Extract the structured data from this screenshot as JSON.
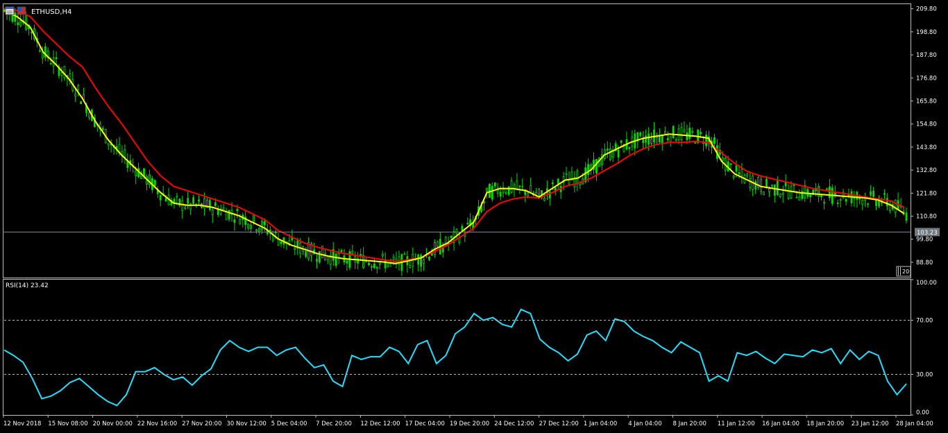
{
  "window": {
    "symbol_label": "ETHUSD,H4",
    "icon": "chart-window-icon"
  },
  "colors": {
    "background": "#000000",
    "frame": "#c0c0c0",
    "candle": "#00dd00",
    "ma_fast": "#ffff00",
    "ma_slow": "#ff0000",
    "rsi": "#1ee0ff",
    "current_price_line": "#7b8b9b",
    "current_price_tag": "#707880"
  },
  "chart_data": [
    {
      "type": "candlestick",
      "title": "ETHUSD,H4",
      "price_axis_ticks": [
        "209.80",
        "198.80",
        "187.80",
        "176.80",
        "165.80",
        "154.80",
        "143.80",
        "132.80",
        "121.80",
        "110.80",
        "99.80",
        "88.80"
      ],
      "ylim": [
        81.5,
        212.0
      ],
      "current_price": 103.23,
      "current_price_label": "103.23",
      "scroll_marker_label": "20",
      "moving_averages": [
        {
          "color": "#ffff00",
          "values": [
            209.0,
            206.0,
            201.0,
            189.0,
            183.0,
            176.0,
            167.0,
            156.0,
            147.0,
            140.0,
            134.0,
            128.0,
            122.0,
            117.0,
            116.0,
            116.0,
            115.0,
            113.0,
            111.0,
            108.0,
            105.0,
            100.0,
            97.0,
            95.0,
            93.0,
            91.5,
            90.5,
            90.0,
            89.5,
            89.0,
            88.2,
            89.5,
            91.0,
            95.0,
            98.0,
            103.0,
            108.0,
            122.0,
            124.0,
            124.0,
            123.0,
            120.0,
            124.0,
            128.0,
            129.0,
            133.0,
            140.0,
            143.0,
            146.0,
            148.0,
            149.0,
            150.0,
            149.5,
            149.0,
            148.0,
            137.0,
            131.0,
            128.0,
            125.0,
            124.0,
            123.0,
            122.0,
            121.5,
            121.0,
            120.5,
            120.0,
            119.5,
            118.5,
            116.0,
            112.0
          ]
        },
        {
          "color": "#ff0000",
          "values": [
            210.0,
            209.0,
            206.0,
            199.0,
            193.0,
            187.0,
            182.0,
            172.0,
            163.0,
            155.0,
            146.0,
            137.0,
            130.0,
            125.0,
            123.0,
            121.0,
            119.0,
            117.0,
            115.0,
            112.0,
            109.0,
            104.0,
            101.0,
            98.0,
            96.0,
            94.5,
            93.0,
            92.0,
            91.0,
            90.0,
            89.2,
            90.0,
            91.0,
            94.0,
            97.0,
            101.0,
            105.0,
            113.0,
            117.0,
            119.0,
            120.0,
            119.5,
            122.0,
            125.0,
            126.5,
            129.0,
            132.5,
            136.0,
            140.0,
            143.0,
            145.0,
            146.0,
            146.0,
            146.5,
            146.0,
            141.0,
            136.0,
            132.0,
            130.0,
            128.5,
            127.0,
            125.5,
            124.0,
            123.0,
            122.0,
            121.0,
            120.0,
            119.0,
            118.0,
            115.0
          ]
        }
      ]
    },
    {
      "type": "line",
      "title": "RSI(14) 23.42",
      "ylim": [
        0,
        100
      ],
      "y_ticks": [
        "100.00",
        "70.00",
        "30.00",
        "0.00"
      ],
      "levels": [
        70,
        30
      ],
      "series": [
        {
          "color": "#1ee0ff",
          "values": [
            48,
            44,
            39,
            27,
            12,
            14,
            18,
            24,
            27,
            21,
            15,
            10,
            7,
            15,
            32,
            32,
            35,
            30,
            26,
            28,
            22,
            29,
            34,
            48,
            55,
            50,
            47,
            50,
            50,
            44,
            48,
            50,
            42,
            35,
            37,
            25,
            21,
            44,
            41,
            43,
            43,
            50,
            47,
            38,
            52,
            55,
            38,
            44,
            60,
            65,
            75,
            70,
            72,
            67,
            65,
            78,
            75,
            56,
            50,
            46,
            40,
            45,
            59,
            62,
            55,
            71,
            69,
            62,
            58,
            55,
            50,
            46,
            54,
            50,
            46,
            25,
            29,
            25,
            46,
            44,
            47,
            42,
            38,
            45,
            44,
            43,
            48,
            46,
            49,
            38,
            48,
            41,
            47,
            44,
            25,
            15,
            23
          ]
        }
      ]
    }
  ],
  "x_axis": {
    "labels": [
      "12 Nov 2018",
      "15 Nov 08:00",
      "20 Nov 00:00",
      "22 Nov 16:00",
      "27 Nov 20:00",
      "30 Nov 12:00",
      "5 Dec 04:00",
      "7 Dec 20:00",
      "12 Dec 12:00",
      "17 Dec 04:00",
      "19 Dec 20:00",
      "24 Dec 12:00",
      "27 Dec 12:00",
      "1 Jan 04:00",
      "4 Jan 04:00",
      "8 Jan 20:00",
      "11 Jan 12:00",
      "16 Jan 04:00",
      "18 Jan 20:00",
      "23 Jan 12:00",
      "28 Jan 04:00"
    ]
  }
}
